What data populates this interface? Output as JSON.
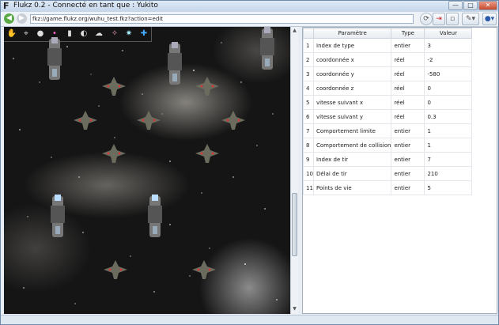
{
  "window": {
    "app_glyph": "F",
    "title": "Flukz 0.2  -  Connecté en tant que : Yukito",
    "controls": {
      "minimize": "—",
      "maximize": "□",
      "close": "✕"
    }
  },
  "navbar": {
    "back_icon": "arrow-left-icon",
    "forward_icon": "arrow-right-icon",
    "url": "fkz://game.flukz.org/wuhu_test.fkz?action=edit",
    "buttons": [
      "refresh-icon",
      "exit-icon",
      "save-icon",
      "tools-icon",
      "user-icon"
    ]
  },
  "palette": {
    "tools": [
      "hand-icon",
      "ship-icon",
      "planet-icon",
      "orb-icon",
      "pillar-icon",
      "rock-icon",
      "cloud-icon",
      "star-ship-icon",
      "star-icon",
      "move-icon"
    ]
  },
  "properties": {
    "columns": [
      "",
      "Paramètre",
      "Type",
      "Valeur"
    ],
    "rows": [
      {
        "index": "1",
        "param": "Index de type",
        "type": "entier",
        "value": "3"
      },
      {
        "index": "2",
        "param": "coordonnée x",
        "type": "réel",
        "value": "-2"
      },
      {
        "index": "3",
        "param": "coordonnée y",
        "type": "réel",
        "value": "-580"
      },
      {
        "index": "4",
        "param": "coordonnée z",
        "type": "réel",
        "value": "0"
      },
      {
        "index": "5",
        "param": "vitesse suivant x",
        "type": "réel",
        "value": "0"
      },
      {
        "index": "6",
        "param": "vitesse suivant y",
        "type": "réel",
        "value": "0.3"
      },
      {
        "index": "7",
        "param": "Comportement limite",
        "type": "entier",
        "value": "1"
      },
      {
        "index": "8",
        "param": "Comportement de collision",
        "type": "entier",
        "value": "1"
      },
      {
        "index": "9",
        "param": "Index de tir",
        "type": "entier",
        "value": "7"
      },
      {
        "index": "10",
        "param": "Délai de tir",
        "type": "entier",
        "value": "210"
      },
      {
        "index": "11",
        "param": "Points de vie",
        "type": "entier",
        "value": "5"
      }
    ]
  },
  "colors": {
    "accent": "#2b5aa8",
    "back_green": "#5aa945",
    "close_red": "#c64a2f"
  }
}
